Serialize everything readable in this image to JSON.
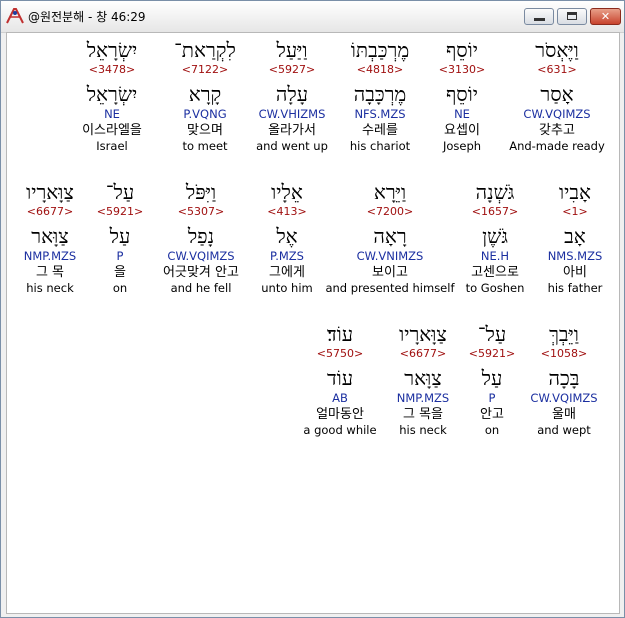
{
  "window": {
    "title": "@원전분해 - 창 46:29",
    "controls": {
      "minimize": "",
      "maximize": "",
      "close": "✕"
    }
  },
  "rows": [
    {
      "words": [
        {
          "hebrew": "וַיֶּאְסֹר",
          "strong": "<631>",
          "lemma": "אָסַר",
          "parse": "CW.VQIMZS",
          "korean": "갖추고",
          "english": "And-made ready",
          "highlight": true
        },
        {
          "hebrew": "יוֹסֵף",
          "strong": "<3130>",
          "lemma": "יוֹסֵף",
          "parse": "NE",
          "korean": "요셉이",
          "english": "Joseph"
        },
        {
          "hebrew": "מֶרְכַּבְתּוֹ",
          "strong": "<4818>",
          "lemma": "מֶרְכָּבָה",
          "parse": "NFS.MZS",
          "korean": "수레를",
          "english": "his chariot"
        },
        {
          "hebrew": "וַיַּעַל",
          "strong": "<5927>",
          "lemma": "עָלָה",
          "parse": "CW.VHIZMS",
          "korean": "올라가서",
          "english": "and went up"
        },
        {
          "hebrew": "לִקְרַאת־",
          "strong": "<7122>",
          "lemma": "קָרָא",
          "parse": "P.VQNG",
          "korean": "맞으며",
          "english": "to meet"
        },
        {
          "hebrew": "יִשְׂרָאֵל",
          "strong": "<3478>",
          "lemma": "יִשְׂרָאֵל",
          "parse": "NE",
          "korean": "이스라엘을",
          "english": "Israel"
        }
      ]
    },
    {
      "words": [
        {
          "hebrew": "אָבִיו",
          "strong": "<1>",
          "lemma": "אָב",
          "parse": "NMS.MZS",
          "korean": "아비",
          "english": "his father"
        },
        {
          "hebrew": "גֹּשְׁנָה",
          "strong": "<1657>",
          "lemma": "גֹּשֶׁן",
          "parse": "NE.H",
          "korean": "고센으로",
          "english": "to Goshen"
        },
        {
          "hebrew": "וַיֵּרָא",
          "strong": "<7200>",
          "lemma": "רָאָה",
          "parse": "CW.VNIMZS",
          "korean": "보이고",
          "english": "and presented himself"
        },
        {
          "hebrew": "אֵלָיו",
          "strong": "<413>",
          "lemma": "אֶל",
          "parse": "P.MZS",
          "korean": "그에게",
          "english": "unto him"
        },
        {
          "hebrew": "וַיִּפֹּל",
          "strong": "<5307>",
          "lemma": "נָפַל",
          "parse": "CW.VQIMZS",
          "korean": "어긋맞겨 안고",
          "english": "and he fell"
        },
        {
          "hebrew": "עַל־",
          "strong": "<5921>",
          "lemma": "עַל",
          "parse": "P",
          "korean": "을",
          "english": "on"
        },
        {
          "hebrew": "צַוָּארָיו",
          "strong": "<6677>",
          "lemma": "צַוָּאר",
          "parse": "NMP.MZS",
          "korean": "그 목",
          "english": "his neck"
        }
      ]
    },
    {
      "words": [
        {
          "hebrew": "וַיֵּבְךְּ",
          "strong": "<1058>",
          "lemma": "בָּכָה",
          "parse": "CW.VQIMZS",
          "korean": "울매",
          "english": "and wept"
        },
        {
          "hebrew": "עַל־",
          "strong": "<5921>",
          "lemma": "עַל",
          "parse": "P",
          "korean": "안고",
          "english": "on"
        },
        {
          "hebrew": "צַוָּארָיו",
          "strong": "<6677>",
          "lemma": "צַוָּאר",
          "parse": "NMP.MZS",
          "korean": "그 목을",
          "english": "his neck"
        },
        {
          "hebrew": "עוֹד׃",
          "strong": "<5750>",
          "lemma": "עוֹד",
          "parse": "AB",
          "korean": "얼마동안",
          "english": "a good while"
        }
      ]
    }
  ]
}
